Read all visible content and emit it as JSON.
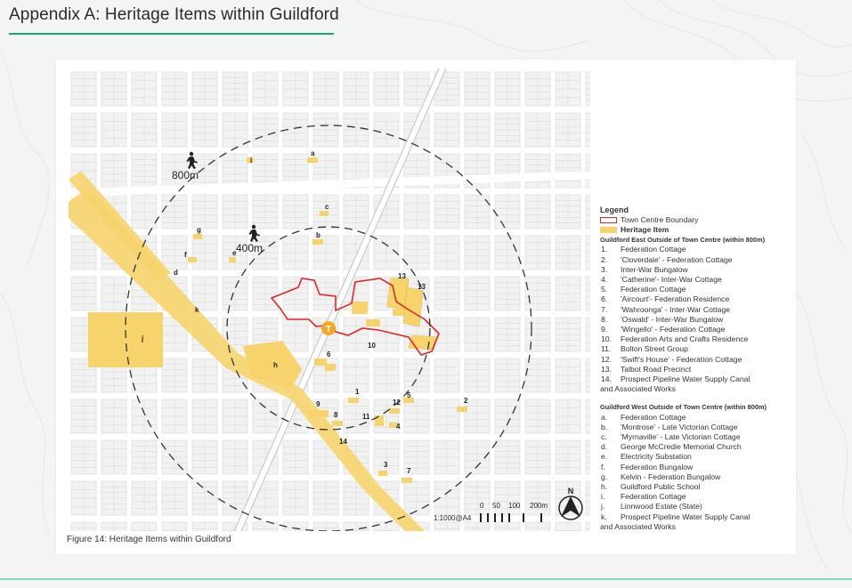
{
  "header": {
    "title": "Appendix A: Heritage Items within Guildford"
  },
  "figure": {
    "caption": "Figure 14: Heritage Items within Guildford"
  },
  "map": {
    "walk_ring_outer": "800m",
    "walk_ring_inner": "400m",
    "station_marker": "T",
    "scale_label": "1:1000@A4",
    "scale_ticks": [
      "0",
      "50",
      "100",
      "200m"
    ],
    "north_label": "N",
    "item_labels": {
      "n1": "1",
      "n2": "2",
      "n3": "3",
      "n4": "4",
      "n5": "5",
      "n6": "6",
      "n7": "7",
      "n8": "8",
      "n9": "9",
      "n10": "10",
      "n11": "11",
      "n12": "12",
      "n13a": "13",
      "n13b": "13",
      "n14": "14",
      "a": "a",
      "b": "b",
      "c": "c",
      "d": "d",
      "e": "e",
      "f": "f",
      "g": "g",
      "h": "h",
      "i": "i",
      "j": "j",
      "k": "k"
    },
    "colors": {
      "heritage_fill": "#f6d46b",
      "boundary_stroke": "#e0262c",
      "station_fill": "#f5a623",
      "street_grid": "#c9c9c9",
      "ring_stroke": "#333333"
    }
  },
  "legend": {
    "title": "Legend",
    "boundary_label": "Town Centre Boundary",
    "heritage_label": "Heritage Item",
    "east_heading": "Guildford East Outside of Town Centre (within 800m)",
    "east_items": [
      {
        "num": "1.",
        "text": "Federation Cottage"
      },
      {
        "num": "2.",
        "text": "'Cloverdale' - Federation Cottage"
      },
      {
        "num": "3.",
        "text": "Inter-War Bungalow"
      },
      {
        "num": "4.",
        "text": "'Catherine'- Inter-War Cottage"
      },
      {
        "num": "5.",
        "text": "Federation Cottage"
      },
      {
        "num": "6.",
        "text": "'Aircourt'- Federation Residence"
      },
      {
        "num": "7.",
        "text": "'Wahroonga' - Inter-War Cottage"
      },
      {
        "num": "8.",
        "text": "'Oswald' - Inter-War Bungalow"
      },
      {
        "num": "9.",
        "text": "'Wingello' - Federation Cottage"
      },
      {
        "num": "10.",
        "text": "Federation Arts and Crafts Residence"
      },
      {
        "num": "11.",
        "text": "Bolton Street Group"
      },
      {
        "num": "12.",
        "text": "'Swift's House' - Federation Cottage"
      },
      {
        "num": "13.",
        "text": "Talbot Road Precinct"
      },
      {
        "num": "14.",
        "text": "Prospect Pipeline Water Supply Canal"
      }
    ],
    "east_item_14_continued": "and Associated Works",
    "west_heading": "Guildford West Outside of Town Centre (within 800m)",
    "west_items": [
      {
        "num": "a.",
        "text": "Federation Cottage"
      },
      {
        "num": "b.",
        "text": "'Montrose' - Late Victorian Cottage"
      },
      {
        "num": "c.",
        "text": "'Myrnaville' - Late Victorian Cottage"
      },
      {
        "num": "d.",
        "text": "George McCredie Memorial Church"
      },
      {
        "num": "e.",
        "text": "Electricity Substation"
      },
      {
        "num": "f.",
        "text": "Federation Bungalow"
      },
      {
        "num": "g.",
        "text": "Kelvin - Federation Bungalow"
      },
      {
        "num": "h.",
        "text": "Guildford Public School"
      },
      {
        "num": "i.",
        "text": "Federation Cottage"
      },
      {
        "num": "j.",
        "text": "Linnwood Estate (State)"
      },
      {
        "num": "k.",
        "text": "Prospect Pipeline Water Supply Canal"
      }
    ],
    "west_item_k_continued": "and Associated Works"
  }
}
